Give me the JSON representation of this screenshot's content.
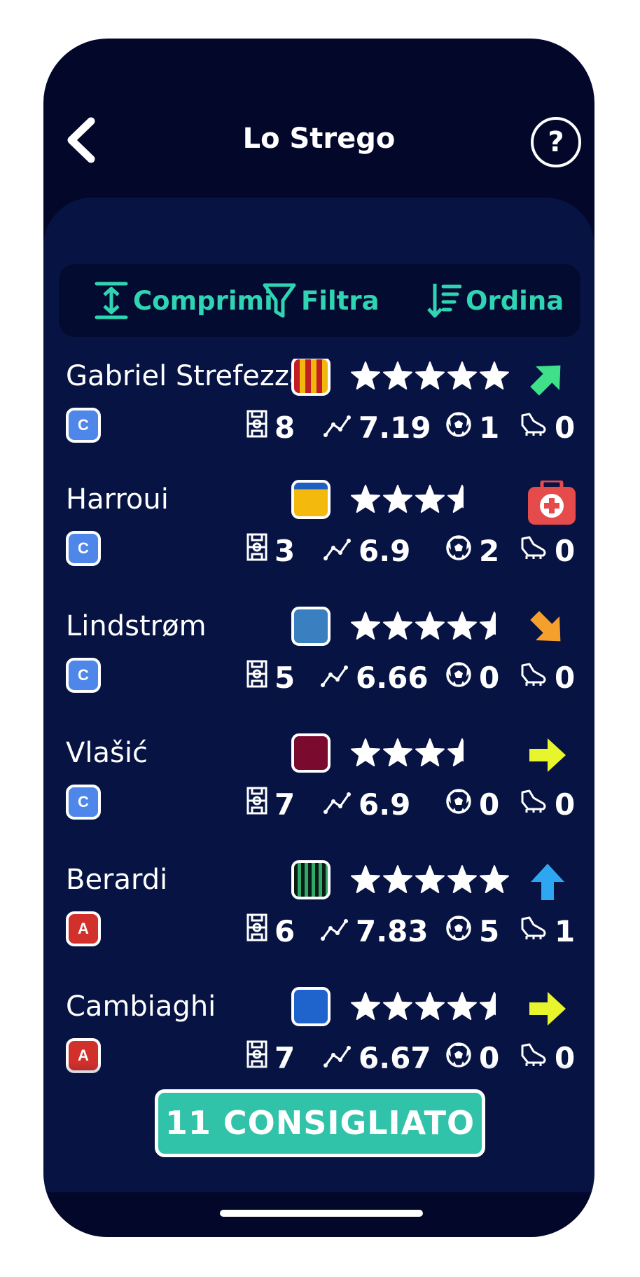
{
  "header": {
    "title": "Lo Strego"
  },
  "toolbar": {
    "compress": "Comprimi",
    "filter": "Filtra",
    "sort": "Ordina"
  },
  "players": [
    {
      "name": "Gabriel Strefezza",
      "role": "C",
      "jersey": "stripes-yellow-red",
      "rating": 5,
      "trend": "up-right",
      "apps": "8",
      "avg": "7.19",
      "goals": "1",
      "assists": "0"
    },
    {
      "name": "Harroui",
      "role": "C",
      "jersey": "yellow-blue",
      "rating": 3.5,
      "trend": "injured",
      "apps": "3",
      "avg": "6.9",
      "goals": "2",
      "assists": "0"
    },
    {
      "name": "Lindstrøm",
      "role": "C",
      "jersey": "steel-blue",
      "rating": 4.5,
      "trend": "down-right",
      "apps": "5",
      "avg": "6.66",
      "goals": "0",
      "assists": "0"
    },
    {
      "name": "Vlašić",
      "role": "C",
      "jersey": "maroon",
      "rating": 3.5,
      "trend": "right",
      "apps": "7",
      "avg": "6.9",
      "goals": "0",
      "assists": "0"
    },
    {
      "name": "Berardi",
      "role": "A",
      "jersey": "stripes-green-black",
      "rating": 5,
      "trend": "up",
      "apps": "6",
      "avg": "7.83",
      "goals": "5",
      "assists": "1"
    },
    {
      "name": "Cambiaghi",
      "role": "A",
      "jersey": "blue",
      "rating": 4.5,
      "trend": "right",
      "apps": "7",
      "avg": "6.67",
      "goals": "0",
      "assists": "0"
    }
  ],
  "cta": {
    "label": "11 CONSIGLIATO"
  },
  "colors": {
    "accent": "#2fd4b3",
    "background": "#03072a",
    "panel": "#071443",
    "cta": "#31c3a9",
    "role_c": "#4e86ea",
    "role_a": "#d2312b"
  }
}
